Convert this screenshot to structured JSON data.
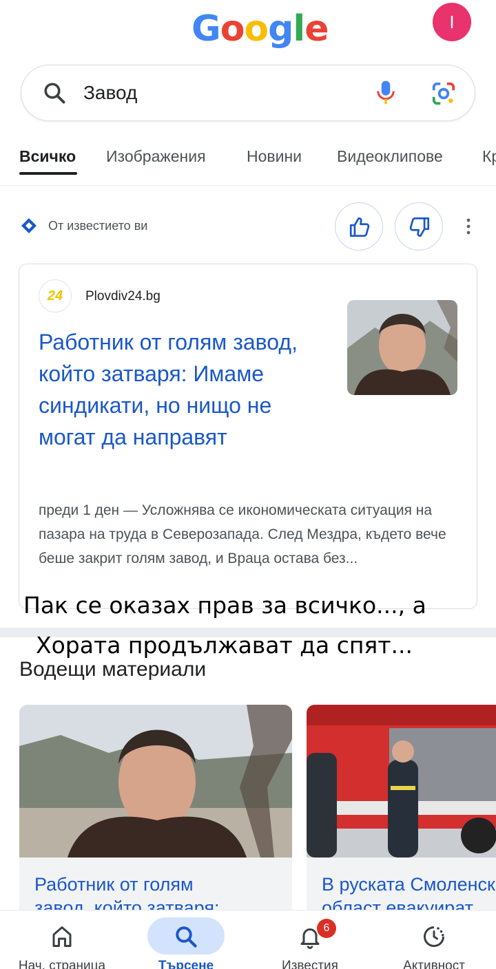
{
  "header": {
    "logo_letters": [
      "G",
      "o",
      "o",
      "g",
      "l",
      "e"
    ],
    "logo_colors": [
      "#4285F4",
      "#EA4335",
      "#FBBC05",
      "#4285F4",
      "#34A853",
      "#EA4335"
    ],
    "avatar_initial": "I",
    "avatar_color": "#e8336d"
  },
  "search": {
    "query": "Завод",
    "icons": [
      "search-icon",
      "mic-icon",
      "lens-icon"
    ]
  },
  "tabs": [
    {
      "label": "Всичко",
      "active": true
    },
    {
      "label": "Изображения",
      "active": false
    },
    {
      "label": "Новини",
      "active": false
    },
    {
      "label": "Видеоклипове",
      "active": false
    },
    {
      "label": "Кр",
      "active": false
    }
  ],
  "notification_row": {
    "label": "От известието ви",
    "icons": [
      "sparkle-diamond-icon",
      "thumbs-up-icon",
      "thumbs-down-icon",
      "more-vert-icon"
    ]
  },
  "featured_card": {
    "source_logo_text": "24",
    "source_name": "Plovdiv24.bg",
    "title": "Работник от голям завод, който затваря: Имаме синдикати, но нищо не могат да направят",
    "snippet": "преди 1 ден — Усложнява се икономическата ситуация на пазара на труда в Северозапада. След Мездра, където вече беше закрит голям завод, и Враца остава без..."
  },
  "overlay": {
    "line1": "Пак се оказах прав за всичко..., а",
    "line2": "Хората продължават да спят..."
  },
  "top_stories": {
    "heading": "Водещи материали",
    "items": [
      {
        "title_line1": "Работник от голям",
        "title_line2": "завод, който затваря:"
      },
      {
        "title_line1": "В руската Смоленск",
        "title_line2": "област евакуират"
      }
    ]
  },
  "bottom_nav": [
    {
      "label": "Нач. страница",
      "icon": "home-icon",
      "active": false
    },
    {
      "label": "Търсене",
      "icon": "search-icon",
      "active": true
    },
    {
      "label": "Известия",
      "icon": "bell-icon",
      "active": false,
      "badge": "6"
    },
    {
      "label": "Активност",
      "icon": "activity-icon",
      "active": false
    }
  ],
  "colors": {
    "link_blue": "#1a57c9",
    "nav_active_pill": "#d3e3fd",
    "badge_red": "#d93025"
  }
}
